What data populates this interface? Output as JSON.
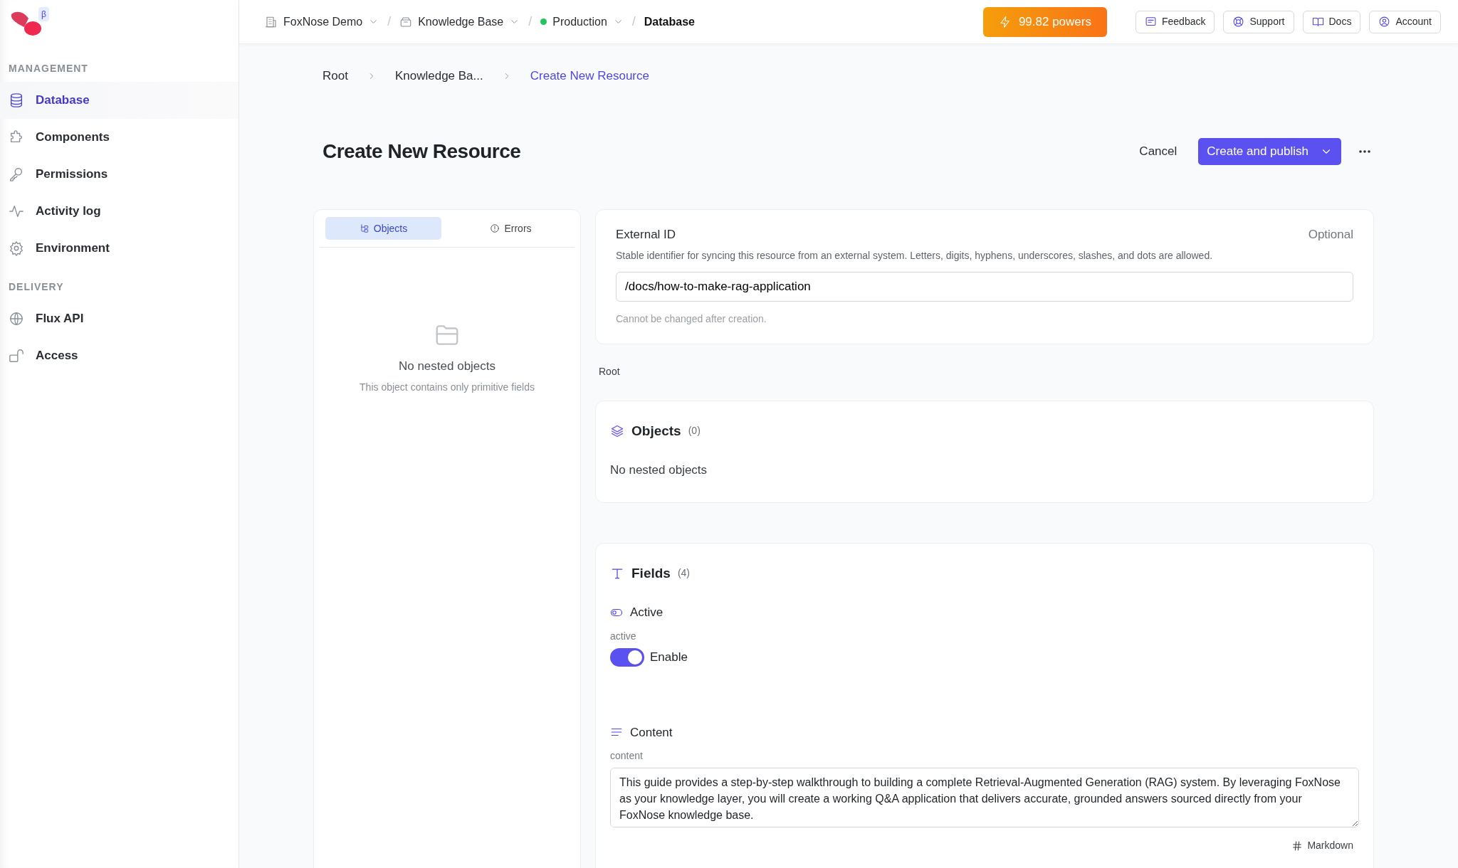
{
  "logo": {
    "badge": "β"
  },
  "sidebar": {
    "sections": [
      {
        "title": "MANAGEMENT",
        "items": [
          {
            "label": "Database",
            "selected": true
          },
          {
            "label": "Components",
            "selected": false
          },
          {
            "label": "Permissions",
            "selected": false
          },
          {
            "label": "Activity log",
            "selected": false
          },
          {
            "label": "Environment",
            "selected": false
          }
        ]
      },
      {
        "title": "DELIVERY",
        "items": [
          {
            "label": "Flux API",
            "selected": false
          },
          {
            "label": "Access",
            "selected": false
          }
        ]
      }
    ]
  },
  "topbar": {
    "crumbs": [
      {
        "label": "FoxNose Demo",
        "kind": "org",
        "dropdown": true
      },
      {
        "separator": "/",
        "label": "Knowledge Base",
        "kind": "project",
        "dropdown": true
      },
      {
        "separator": "/",
        "label": "Production",
        "kind": "env",
        "dropdown": true,
        "color": "#22c55e"
      },
      {
        "separator": "/",
        "label": "Database",
        "kind": "page"
      }
    ],
    "powers": "99.82 powers",
    "buttons": [
      {
        "label": "Feedback"
      },
      {
        "label": "Support"
      },
      {
        "label": "Docs"
      },
      {
        "label": "Account"
      }
    ]
  },
  "breadcrumb": [
    {
      "label": "Root",
      "selected": false
    },
    {
      "label": "Knowledge Ba...",
      "selected": false
    },
    {
      "label": "Create New Resource",
      "selected": true
    }
  ],
  "title": "Create New Resource",
  "actions": {
    "cancel": "Cancel",
    "primary": "Create and publish"
  },
  "left_panel": {
    "tabs": [
      {
        "label": "Objects",
        "selected": true
      },
      {
        "label": "Errors",
        "selected": false
      }
    ],
    "empty_title": "No nested objects",
    "empty_text": "This object contains only primitive fields"
  },
  "external_id": {
    "label": "External ID",
    "optional": "Optional",
    "description": "Stable identifier for syncing this resource from an external system. Letters, digits, hyphens, underscores, slashes, and dots are allowed.",
    "value": "/docs/how-to-make-rag-application",
    "hint": "Cannot be changed after creation."
  },
  "path_label": "Root",
  "objects_section": {
    "title": "Objects",
    "count": "(0)",
    "empty": "No nested objects"
  },
  "fields_section": {
    "title": "Fields",
    "count": "(4)",
    "fields": [
      {
        "kind": "toggle",
        "label": "Active",
        "key": "active",
        "on": true,
        "toggle_label": "Enable"
      },
      {
        "kind": "text",
        "label": "Content",
        "key": "content",
        "value": "This guide provides a step-by-step walkthrough to building a complete Retrieval-Augmented Generation (RAG) system. By leveraging FoxNose as your knowledge layer, you will create a working Q&A application that delivers accurate, grounded answers sourced directly from your FoxNose knowledge base.",
        "format": "Markdown"
      }
    ]
  }
}
